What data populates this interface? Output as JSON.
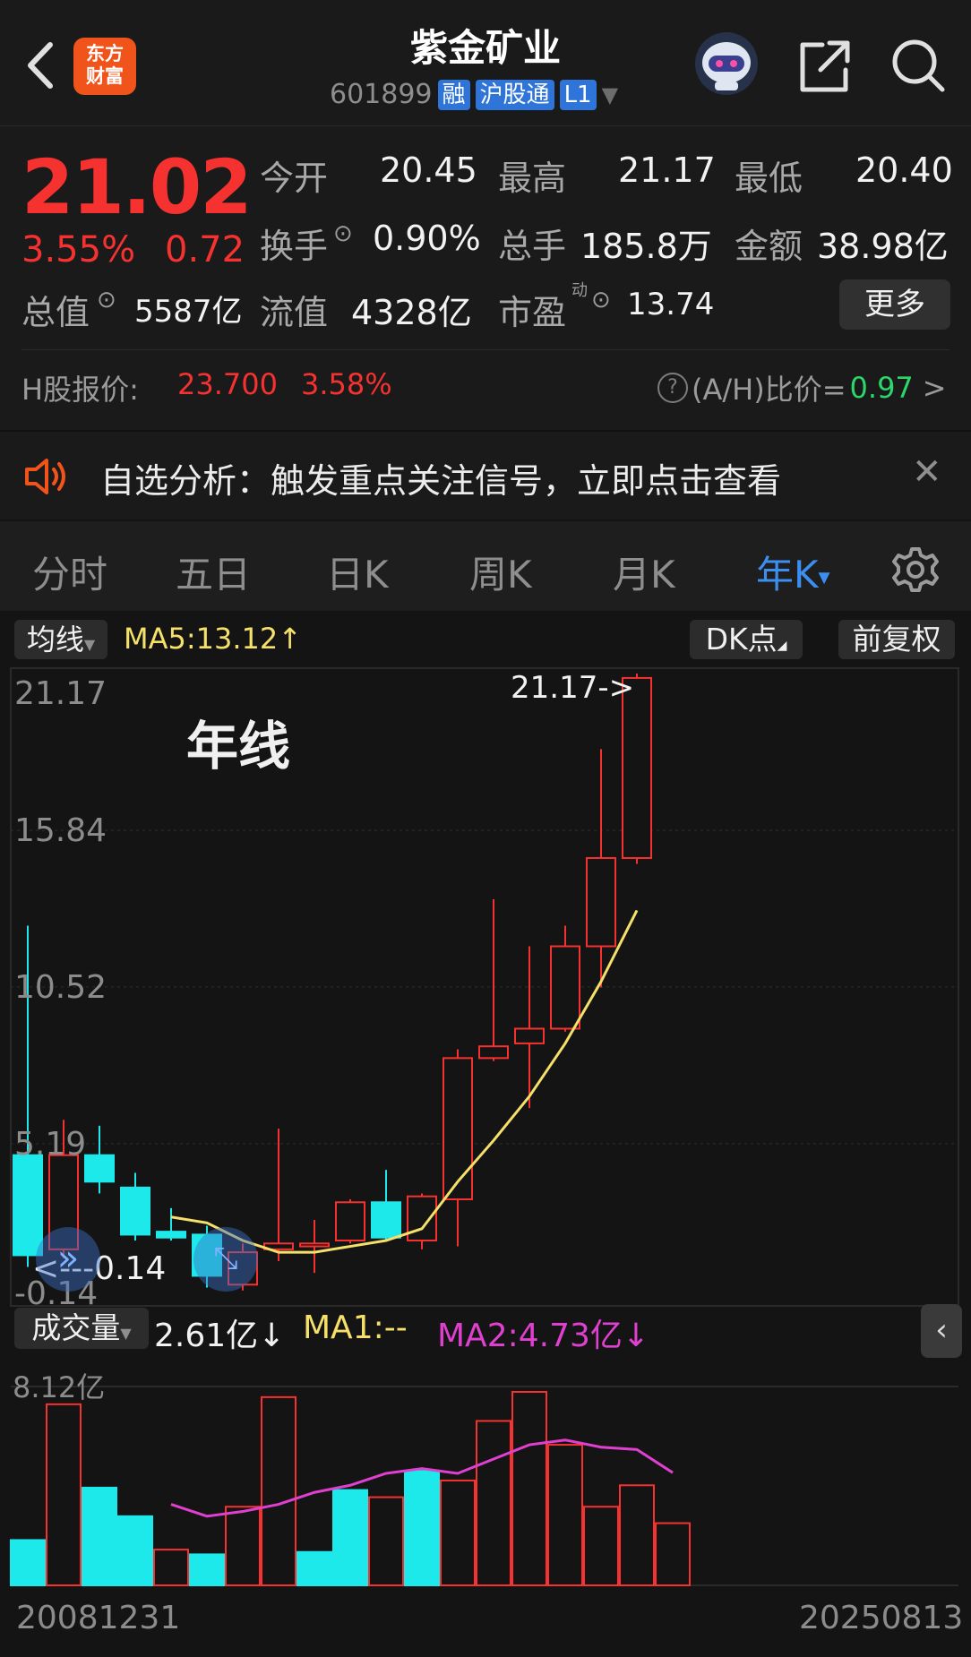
{
  "header": {
    "back_icon": "chevron-left-icon",
    "logo_text_line1": "东方",
    "logo_text_line2": "财富",
    "title": "紫金矿业",
    "code": "601899",
    "tag_rong": "融",
    "tag_hgt": "沪股通",
    "tag_level": "L1",
    "assistant_icon": "robot-avatar-icon",
    "share_icon": "share-icon",
    "search_icon": "search-icon"
  },
  "quote": {
    "price": "21.02",
    "change_pct": "3.55%",
    "change_abs": "0.72",
    "open_label": "今开",
    "open": "20.45",
    "high_label": "最高",
    "high": "21.17",
    "low_label": "最低",
    "low": "20.40",
    "turnover_label": "换手",
    "turnover": "0.90%",
    "volume_label": "总手",
    "volume": "185.8万",
    "amount_label": "金额",
    "amount": "38.98亿",
    "mktcap_label": "总值",
    "mktcap": "5587亿",
    "float_label": "流值",
    "float": "4328亿",
    "pe_label": "市盈",
    "pe_sup": "动",
    "pe": "13.74",
    "more_label": "更多",
    "hshare_label": "H股报价:",
    "hshare_price": "23.700",
    "hshare_pct": "3.58%",
    "ah_label": "(A/H)比价=",
    "ah_value": "0.97",
    "ah_arrow": ">"
  },
  "notice": {
    "text": "自选分析：触发重点关注信号，立即点击查看",
    "close": "✕"
  },
  "tabs": {
    "items": [
      "分时",
      "五日",
      "日K",
      "周K",
      "月K",
      "年K"
    ],
    "active": "年K",
    "active_caret": "▾"
  },
  "chart_toolbar": {
    "ma_select": "均线",
    "ma5_text": "MA5:13.12↑",
    "dk_label": "DK点",
    "adj_label": "前复权"
  },
  "chart_labels": {
    "overlay_title": "年线",
    "max_annot": "21.17->",
    "min_annot": "<---0.14",
    "vol_select": "成交量",
    "vol_value": "2.61亿↓",
    "vol_ma1": "MA1:--",
    "vol_ma2": "MA2:4.73亿↓",
    "vol_axis_max": "8.12亿",
    "date_start": "20081231",
    "date_end": "20250813"
  },
  "colors": {
    "up": "#f5322f",
    "down": "#1de9ea",
    "ma": "#f5e16a",
    "vol_ma2": "#e040d0",
    "accent": "#2f74d8"
  },
  "chart_data": {
    "type": "candlestick",
    "ylim": [
      -0.14,
      21.17
    ],
    "y_ticks": [
      "21.17",
      "15.84",
      "10.52",
      "5.19",
      "-0.14"
    ],
    "candles": [
      {
        "o": 4.8,
        "c": 1.4,
        "h": 12.6,
        "l": 1.0
      },
      {
        "o": 1.6,
        "c": 4.8,
        "h": 6.0,
        "l": 1.3
      },
      {
        "o": 4.8,
        "c": 3.9,
        "h": 5.8,
        "l": 3.5
      },
      {
        "o": 3.7,
        "c": 2.1,
        "h": 4.2,
        "l": 1.9
      },
      {
        "o": 2.2,
        "c": 2.0,
        "h": 3.0,
        "l": 1.9
      },
      {
        "o": 2.1,
        "c": 0.7,
        "h": 2.4,
        "l": 0.3
      },
      {
        "o": 0.4,
        "c": 1.5,
        "h": 1.8,
        "l": 0.2
      },
      {
        "o": 1.6,
        "c": 1.8,
        "h": 5.7,
        "l": 1.2
      },
      {
        "o": 1.7,
        "c": 1.8,
        "h": 2.6,
        "l": 0.8
      },
      {
        "o": 1.9,
        "c": 3.2,
        "h": 3.3,
        "l": 1.8
      },
      {
        "o": 3.2,
        "c": 2.0,
        "h": 4.3,
        "l": 1.9
      },
      {
        "o": 1.9,
        "c": 3.4,
        "h": 3.5,
        "l": 1.6
      },
      {
        "o": 3.3,
        "c": 8.1,
        "h": 8.4,
        "l": 1.7
      },
      {
        "o": 8.1,
        "c": 8.5,
        "h": 13.5,
        "l": 8.0
      },
      {
        "o": 8.6,
        "c": 9.1,
        "h": 11.9,
        "l": 6.4
      },
      {
        "o": 9.1,
        "c": 11.9,
        "h": 12.6,
        "l": 9.0
      },
      {
        "o": 11.9,
        "c": 14.9,
        "h": 18.6,
        "l": 10.5
      },
      {
        "o": 14.9,
        "c": 21.02,
        "h": 21.17,
        "l": 14.7
      }
    ],
    "ma5": [
      null,
      null,
      null,
      null,
      2.7,
      2.5,
      1.9,
      1.5,
      1.5,
      1.7,
      1.9,
      2.3,
      3.9,
      5.3,
      6.8,
      8.6,
      10.7,
      13.12
    ],
    "volume": {
      "ylim": [
        0,
        8.12
      ],
      "values": [
        1.9,
        7.6,
        4.1,
        2.9,
        1.5,
        1.3,
        3.3,
        7.9,
        1.4,
        4.0,
        3.7,
        4.8,
        4.4,
        6.9,
        8.12,
        5.9,
        3.3,
        4.2,
        2.61
      ],
      "up": [
        false,
        true,
        false,
        false,
        true,
        false,
        true,
        true,
        false,
        false,
        true,
        false,
        true,
        true,
        true,
        true,
        true,
        true,
        true
      ],
      "ma2": [
        null,
        null,
        null,
        null,
        3.4,
        2.9,
        3.1,
        3.4,
        3.9,
        4.2,
        4.7,
        4.9,
        4.7,
        5.3,
        5.9,
        6.1,
        5.8,
        5.7,
        4.73
      ]
    }
  }
}
